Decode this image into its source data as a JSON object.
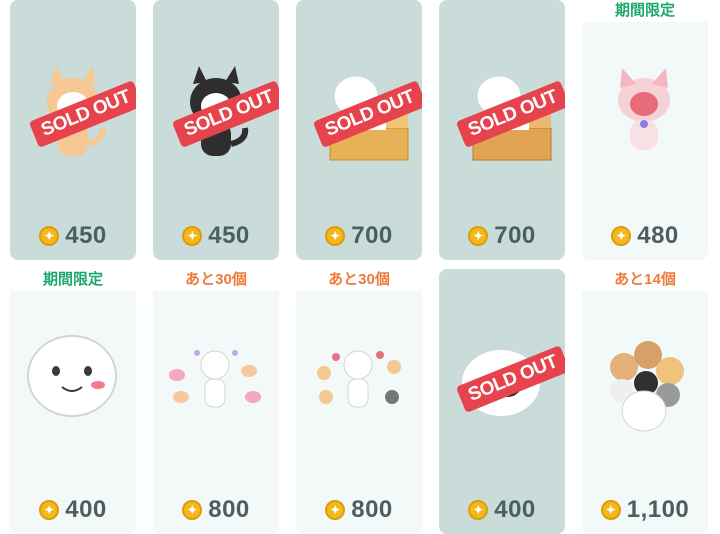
{
  "items": [
    {
      "price": "450",
      "soldout": "SOLD OUT"
    },
    {
      "price": "450",
      "soldout": "SOLD OUT"
    },
    {
      "price": "700",
      "soldout": "SOLD OUT"
    },
    {
      "price": "700",
      "soldout": "SOLD OUT"
    },
    {
      "tag": "期間限定",
      "price": "480"
    },
    {
      "tag": "期間限定",
      "price": "400"
    },
    {
      "tag": "あと30個",
      "price": "800"
    },
    {
      "tag": "あと30個",
      "price": "800"
    },
    {
      "price": "400",
      "soldout": "SOLD OUT"
    },
    {
      "tag": "あと14個",
      "price": "1,100"
    }
  ],
  "icons": {
    "coin": "coin-icon"
  },
  "colors": {
    "soldout": "#e6434d",
    "tag_green": "#1fa86b",
    "tag_orange": "#ee7a3c",
    "price": "#4b5f5e"
  }
}
